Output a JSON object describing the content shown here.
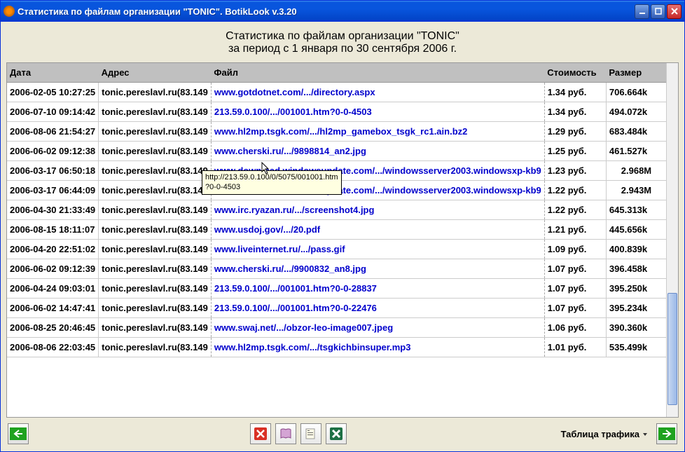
{
  "titlebar": "Статистика по файлам организации \"TONIC\". BotikLook v.3.20",
  "heading_line1": "Статистика по файлам организации \"TONIC\"",
  "heading_line2": "за период с 1 января по 30 сентября 2006 г.",
  "columns": {
    "date": "Дата",
    "addr": "Адрес",
    "file": "Файл",
    "cost": "Стоимость",
    "size": "Размер"
  },
  "tooltip": {
    "line1": "http://213.59.0.100/0/5075/001001.htm",
    "line2": "?0-0-4503"
  },
  "rows": [
    {
      "date": "2006-02-05 10:27:25",
      "addr": "tonic.pereslavl.ru(83.149",
      "file": "www.gotdotnet.com/.../directory.aspx",
      "cost": "1.34 руб.",
      "size": "706.664k"
    },
    {
      "date": "2006-07-10 09:14:42",
      "addr": "tonic.pereslavl.ru(83.149",
      "file": "213.59.0.100/.../001001.htm?0-0-4503",
      "cost": "1.34 руб.",
      "size": "494.072k"
    },
    {
      "date": "2006-08-06 21:54:27",
      "addr": "tonic.pereslavl.ru(83.149",
      "file": "www.hl2mp.tsgk.com/.../hl2mp_gamebox_tsgk_rc1.ain.bz2",
      "cost": "1.29 руб.",
      "size": "683.484k"
    },
    {
      "date": "2006-06-02 09:12:38",
      "addr": "tonic.pereslavl.ru(83.149",
      "file": "www.cherski.ru/.../9898814_an2.jpg",
      "cost": "1.25 руб.",
      "size": "461.527k"
    },
    {
      "date": "2006-03-17 06:50:18",
      "addr": "tonic.pereslavl.ru(83.149",
      "file": "www.download.windowsupdate.com/.../windowsserver2003.windowsxp-kb9",
      "cost": "1.23 руб.",
      "size": "2.968M",
      "sizeM": true
    },
    {
      "date": "2006-03-17 06:44:09",
      "addr": "tonic.pereslavl.ru(83.149",
      "file": "www.download.windowsupdate.com/.../windowsserver2003.windowsxp-kb9",
      "cost": "1.22 руб.",
      "size": "2.943M",
      "sizeM": true
    },
    {
      "date": "2006-04-30 21:33:49",
      "addr": "tonic.pereslavl.ru(83.149",
      "file": "www.irc.ryazan.ru/.../screenshot4.jpg",
      "cost": "1.22 руб.",
      "size": "645.313k"
    },
    {
      "date": "2006-08-15 18:11:07",
      "addr": "tonic.pereslavl.ru(83.149",
      "file": "www.usdoj.gov/.../20.pdf",
      "cost": "1.21 руб.",
      "size": "445.656k"
    },
    {
      "date": "2006-04-20 22:51:02",
      "addr": "tonic.pereslavl.ru(83.149",
      "file": "www.liveinternet.ru/.../pass.gif",
      "cost": "1.09 руб.",
      "size": "400.839k"
    },
    {
      "date": "2006-06-02 09:12:39",
      "addr": "tonic.pereslavl.ru(83.149",
      "file": "www.cherski.ru/.../9900832_an8.jpg",
      "cost": "1.07 руб.",
      "size": "396.458k"
    },
    {
      "date": "2006-04-24 09:03:01",
      "addr": "tonic.pereslavl.ru(83.149",
      "file": "213.59.0.100/.../001001.htm?0-0-28837",
      "cost": "1.07 руб.",
      "size": "395.250k"
    },
    {
      "date": "2006-06-02 14:47:41",
      "addr": "tonic.pereslavl.ru(83.149",
      "file": "213.59.0.100/.../001001.htm?0-0-22476",
      "cost": "1.07 руб.",
      "size": "395.234k"
    },
    {
      "date": "2006-08-25 20:46:45",
      "addr": "tonic.pereslavl.ru(83.149",
      "file": "www.swaj.net/.../obzor-leo-image007.jpeg",
      "cost": "1.06 руб.",
      "size": "390.360k"
    },
    {
      "date": "2006-08-06 22:03:45",
      "addr": "tonic.pereslavl.ru(83.149",
      "file": "www.hl2mp.tsgk.com/.../tsgkichbinsuper.mp3",
      "cost": "1.01 руб.",
      "size": "535.499k"
    }
  ],
  "bottom": {
    "dropdown": "Таблица трафика"
  }
}
